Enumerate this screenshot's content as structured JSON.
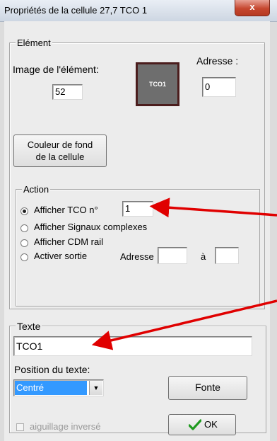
{
  "window": {
    "title": "Propriétés de la cellule 27,7 TCO 1",
    "close_label": "x"
  },
  "element_group": {
    "legend": "Elément",
    "image_label": "Image de l'élément:",
    "image_value": "52",
    "tile_text": "TCO1",
    "address_label": "Adresse :",
    "address_value": "0",
    "bg_color_button": [
      "Couleur de fond",
      "de la cellule"
    ]
  },
  "action_group": {
    "legend": "Action",
    "options": [
      {
        "label": "Afficher TCO n°",
        "checked": true
      },
      {
        "label": "Afficher Signaux complexes",
        "checked": false
      },
      {
        "label": "Afficher CDM rail",
        "checked": false
      },
      {
        "label": "Activer sortie",
        "checked": false
      }
    ],
    "tco_number": "1",
    "sortie_adresse_label": "Adresse",
    "sortie_to_label": "à",
    "sortie_from_value": "",
    "sortie_to_value": ""
  },
  "text_group": {
    "legend": "Texte",
    "text_value": "TCO1",
    "position_label": "Position du texte:",
    "position_selected": "Centré",
    "font_button": "Fonte"
  },
  "footer": {
    "inverted_switch_label": "aiguillage inversé",
    "inverted_switch_checked": false,
    "ok_button": "OK"
  },
  "annotation": {
    "arrow_color": "#e00000"
  }
}
